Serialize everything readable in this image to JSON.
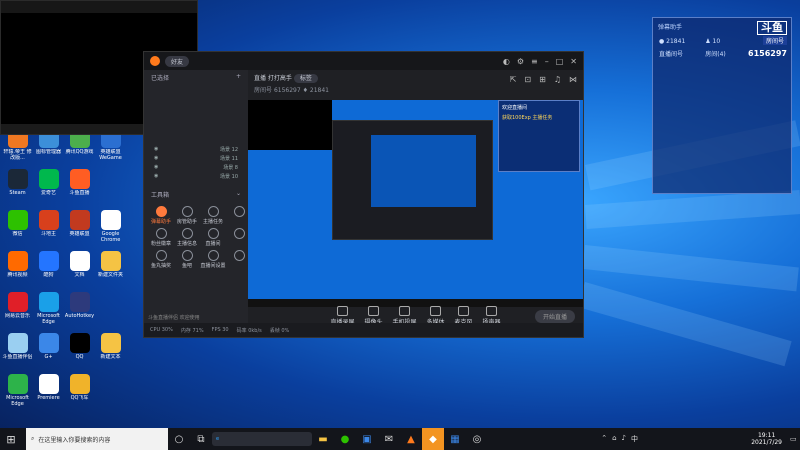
{
  "desktop_icons": [
    {
      "label": "轩辕.帝王 修改版...",
      "icon": "app-icon",
      "color": "#f07822"
    },
    {
      "label": "图标管理器",
      "icon": "app-icon",
      "color": "#3c8fd9"
    },
    {
      "label": "腾讯QQ游戏",
      "icon": "app-icon",
      "color": "#4cae4c"
    },
    {
      "label": "英雄联盟 WeGame",
      "icon": "app-icon",
      "color": "#2b6fd1"
    },
    {
      "label": "Steam",
      "icon": "steam-icon",
      "color": "#1b2838"
    },
    {
      "label": "爱奇艺",
      "icon": "iqiyi-icon",
      "color": "#00b84d"
    },
    {
      "label": "斗鱼直播",
      "icon": "app-icon",
      "color": "#ff5d23"
    },
    {
      "label": "",
      "icon": "",
      "color": ""
    },
    {
      "label": "微信",
      "icon": "wechat-icon",
      "color": "#2dc100"
    },
    {
      "label": "斗地主",
      "icon": "app-icon",
      "color": "#d8401c"
    },
    {
      "label": "英雄联盟",
      "icon": "app-icon",
      "color": "#c23a1f"
    },
    {
      "label": "Google Chrome",
      "icon": "chrome-icon",
      "color": "#ffffff"
    },
    {
      "label": "腾讯视频",
      "icon": "play-icon",
      "color": "#ff6a00"
    },
    {
      "label": "酷狗",
      "icon": "kugou-icon",
      "color": "#2475ff"
    },
    {
      "label": "文档",
      "icon": "doc-icon",
      "color": "#ffffff"
    },
    {
      "label": "新建文件夹",
      "icon": "folder-icon",
      "color": "#f5c344"
    },
    {
      "label": "网易云音乐",
      "icon": "music-icon",
      "color": "#e01f28"
    },
    {
      "label": "Microsoft Edge",
      "icon": "edge-icon",
      "color": "#1aa0e8"
    },
    {
      "label": "AutoHotkey",
      "icon": "app-icon",
      "color": "#2d3a7c"
    },
    {
      "label": "",
      "icon": "",
      "color": ""
    },
    {
      "label": "斗鱼直播伴侣",
      "icon": "app-icon",
      "color": "#9acff1"
    },
    {
      "label": "G+",
      "icon": "app-icon",
      "color": "#3b87e8"
    },
    {
      "label": "QQ",
      "icon": "qq-icon",
      "color": "#000000"
    },
    {
      "label": "新建文本",
      "icon": "folder-icon",
      "color": "#f5c344"
    },
    {
      "label": "Microsoft Edge",
      "icon": "edge-icon",
      "color": "#2db34a"
    },
    {
      "label": "Premiere",
      "icon": "app-icon",
      "color": "#ffffff"
    },
    {
      "label": "QQ飞车",
      "icon": "game-icon",
      "color": "#f0b32a"
    },
    {
      "label": "",
      "icon": "",
      "color": ""
    }
  ],
  "black_window": {
    "bottom_left": "",
    "bottom_right": ""
  },
  "studio": {
    "title_pill": "好友",
    "left": {
      "section_title": "已选择",
      "add_symbol": "+",
      "scenes": [
        {
          "name": "场景 12",
          "on": true
        },
        {
          "name": "场景 11",
          "on": true
        },
        {
          "name": "场景 8",
          "on": true
        },
        {
          "name": "场景 10",
          "on": true
        }
      ],
      "toolbox_title": "工具箱",
      "tools": [
        {
          "label": "弹幕助手",
          "hot": true
        },
        {
          "label": "房管助手",
          "hot": false
        },
        {
          "label": "主播任务",
          "hot": false
        },
        {
          "label": "",
          "hot": false
        },
        {
          "label": "粉丝徽章",
          "hot": false
        },
        {
          "label": "主播信息",
          "hot": false
        },
        {
          "label": "直播间",
          "hot": false
        },
        {
          "label": "",
          "hot": false
        },
        {
          "label": "鱼丸抽奖",
          "hot": false
        },
        {
          "label": "鱼吧",
          "hot": false
        },
        {
          "label": "直播间设置",
          "hot": false
        },
        {
          "label": "",
          "hot": false
        }
      ],
      "tip": "斗鱼直播伴侣 欢迎使用"
    },
    "room": {
      "line1": "直播 打打高手",
      "tag": "标签",
      "line2_left": "房间号",
      "room_id": "6156297",
      "fans": "21841"
    },
    "preview": {
      "banner_title": "欢迎直播间",
      "banner_sub": "获取100Exp 主播任务"
    },
    "controls": [
      {
        "label": "直播录屏",
        "icon": "screen-icon"
      },
      {
        "label": "摄像头",
        "icon": "camera-icon"
      },
      {
        "label": "手机投屏",
        "icon": "phone-icon"
      },
      {
        "label": "多媒体",
        "icon": "media-icon"
      },
      {
        "label": "麦克风",
        "icon": "mic-icon"
      },
      {
        "label": "扬声器",
        "icon": "speaker-icon"
      }
    ],
    "start_label": "开始直播",
    "status": [
      "CPU 30%",
      "内存 71%",
      "FPS 30",
      "码率 0kb/s",
      "丢帧 0%"
    ]
  },
  "overlay": {
    "title": "弹幕助手",
    "fans": "21841",
    "count": "10",
    "row_label": "直播间号",
    "row_mid": "房间(4)",
    "room_id": "6156297",
    "logo_top": "斗鱼",
    "logo_bottom": "房间号"
  },
  "taskbar": {
    "search_placeholder": "在这里输入你要搜索的内容",
    "inner_search": "",
    "time": "19:11",
    "date": "2021/7/29",
    "lang": "中"
  }
}
